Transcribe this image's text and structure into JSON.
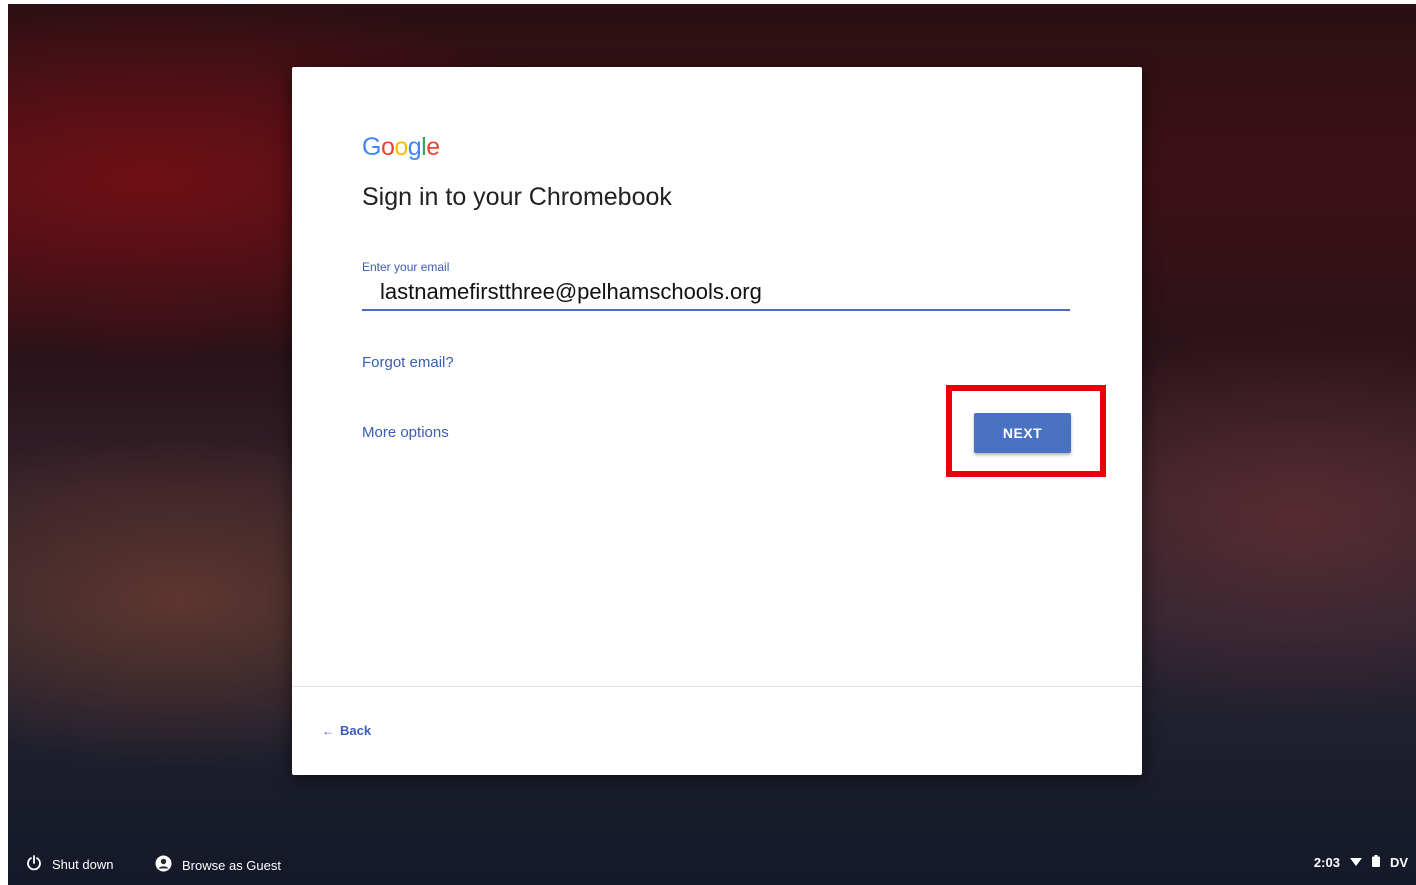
{
  "card": {
    "logo_letters": [
      {
        "char": "G",
        "color": "#4285F4"
      },
      {
        "char": "o",
        "color": "#EA4335"
      },
      {
        "char": "o",
        "color": "#FBBC05"
      },
      {
        "char": "g",
        "color": "#4285F4"
      },
      {
        "char": "l",
        "color": "#34A853"
      },
      {
        "char": "e",
        "color": "#EA4335"
      }
    ],
    "title": "Sign in to your Chromebook",
    "email_label": "Enter your email",
    "email_value": "lastnamefirstthree@pelhamschools.org",
    "forgot_link": "Forgot email?",
    "more_options_link": "More options",
    "next_button": "NEXT",
    "back_button": "Back",
    "back_arrow": "←"
  },
  "shelf": {
    "shutdown_label": "Shut down",
    "guest_label": "Browse as Guest",
    "time": "2:03",
    "user_initials": "DV",
    "icons": [
      "power-icon",
      "account-icon",
      "wifi-icon",
      "battery-icon"
    ]
  },
  "colors": {
    "accent": "#4a72c2",
    "link": "#3a5db5",
    "highlight": "#e8000b"
  }
}
